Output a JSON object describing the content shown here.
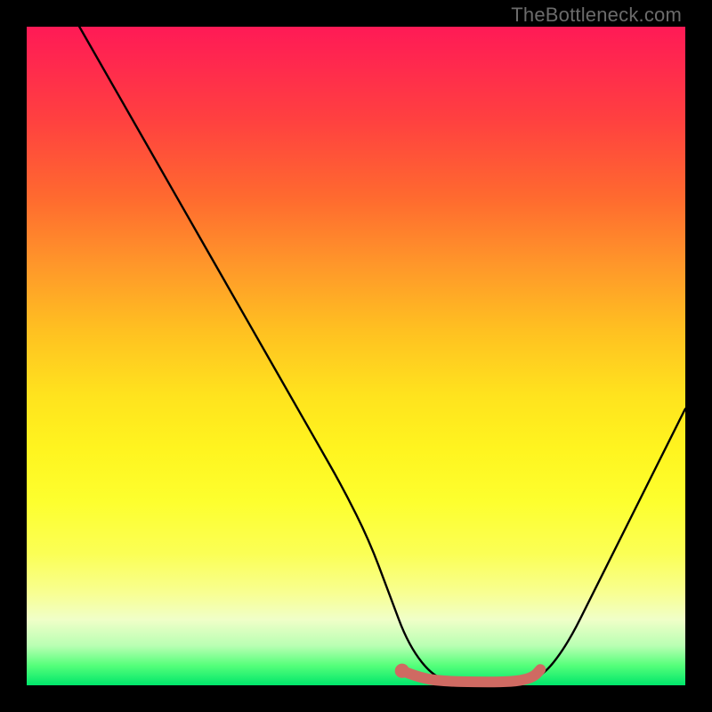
{
  "watermark": "TheBottleneck.com",
  "chart_data": {
    "type": "line",
    "title": "",
    "xlabel": "",
    "ylabel": "",
    "xlim": [
      0,
      100
    ],
    "ylim": [
      0,
      100
    ],
    "series": [
      {
        "name": "bottleneck-curve",
        "x": [
          8,
          12,
          16,
          20,
          24,
          28,
          32,
          36,
          40,
          44,
          48,
          52,
          55,
          58,
          62,
          66,
          70,
          74,
          78,
          82,
          86,
          90,
          94,
          98,
          100
        ],
        "y": [
          100,
          93,
          86,
          79,
          72,
          65,
          58,
          51,
          44,
          37,
          30,
          22,
          14,
          6,
          1,
          0.5,
          0.5,
          0.5,
          1,
          6,
          14,
          22,
          30,
          38,
          42
        ]
      }
    ],
    "highlight": {
      "name": "optimal-range",
      "color": "#cf6a62",
      "x": [
        57,
        60,
        64,
        68,
        72,
        75,
        77,
        78
      ],
      "y": [
        2.2,
        1.0,
        0.6,
        0.5,
        0.5,
        0.7,
        1.3,
        2.4
      ]
    },
    "highlight_marker": {
      "x": 57,
      "y": 2.2,
      "r": 1.1,
      "color": "#cf6a62"
    },
    "background_gradient": {
      "top": "#ff1a56",
      "mid_upper": "#ffc021",
      "mid_lower": "#fdff2e",
      "bottom": "#00e66b"
    }
  }
}
